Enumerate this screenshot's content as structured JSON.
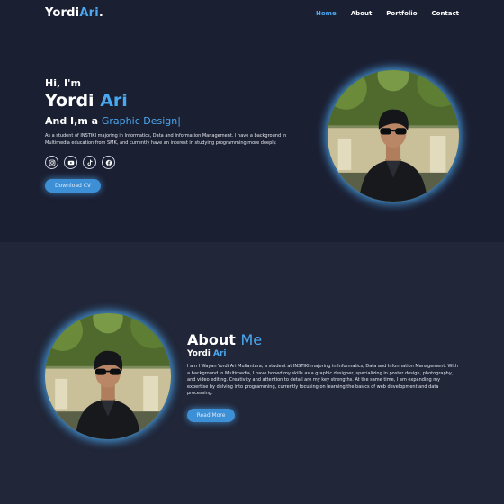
{
  "header": {
    "logo_main": "Yordi",
    "logo_accent": "Ari",
    "logo_dot": ".",
    "nav": [
      {
        "label": "Home",
        "active": true
      },
      {
        "label": "About",
        "active": false
      },
      {
        "label": "Portfolio",
        "active": false
      },
      {
        "label": "Contact",
        "active": false
      }
    ]
  },
  "hero": {
    "greeting": "Hi, I'm",
    "name_first": "Yordi",
    "name_last": "Ari",
    "role_prefix": "And I,m a",
    "role_typed": "Graphic Design",
    "role_cursor": "|",
    "description": "As a student of INSTIKI majoring in Informatics, Data and Information Management. I have a background in Multimedia education from SMK, and currently have an interest in studying programming more deeply.",
    "socials": [
      {
        "icon": "instagram-icon"
      },
      {
        "icon": "youtube-icon"
      },
      {
        "icon": "tiktok-icon"
      },
      {
        "icon": "facebook-icon"
      }
    ],
    "cta_label": "Download CV"
  },
  "about": {
    "title_main": "About",
    "title_accent": "Me",
    "sub_main": "Yordi",
    "sub_accent": "Ari",
    "description": "I am I Wayan Yordi Ari Muliantara, a student at INSTIKI majoring in Informatics, Data and Information Management. With a background in Multimedia, I have honed my skills as a graphic designer, specializing in poster design, photography, and video editing. Creativity and attention to detail are my key strengths. At the same time, I am expanding my expertise by delving into programming, currently focusing on learning the basics of web development and data processing.",
    "cta_label": "Read More"
  },
  "colors": {
    "accent": "#4aa8f0",
    "hero_bg": "#1b1f32",
    "about_bg": "#212638",
    "button": "#3d8fd6"
  }
}
